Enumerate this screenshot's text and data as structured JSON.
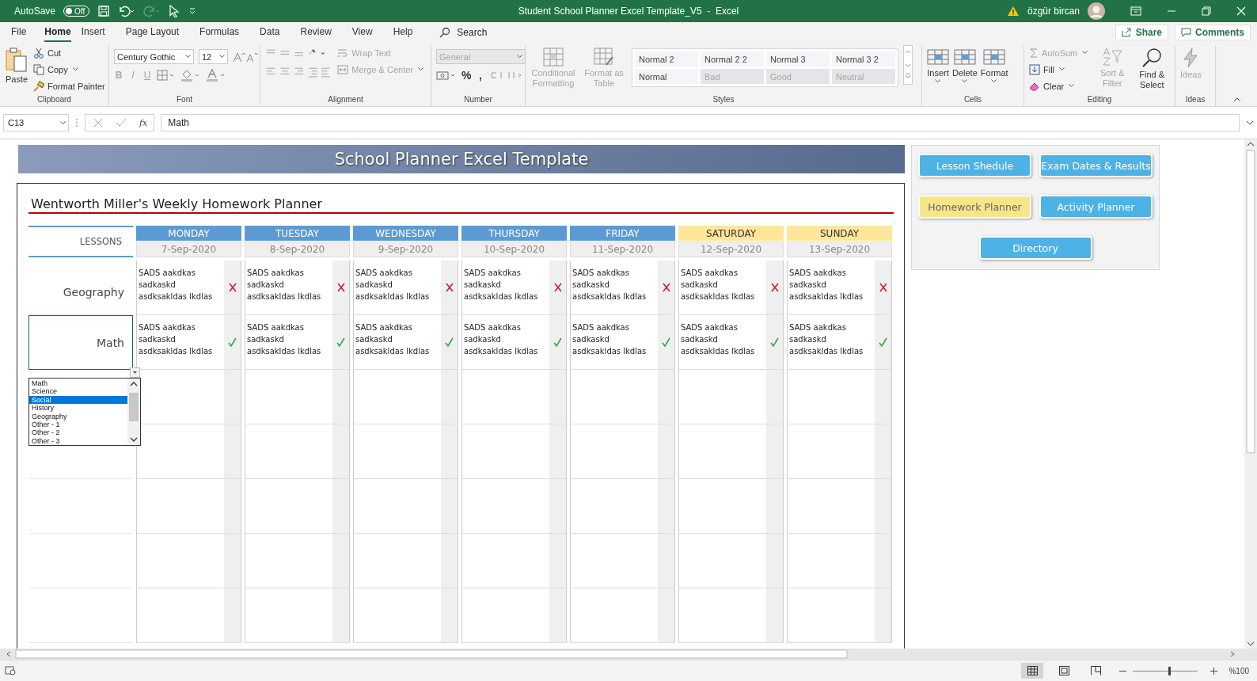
{
  "window": {
    "autosave": {
      "label": "AutoSave",
      "on": false,
      "state": "Off"
    },
    "title": "Student School Planner Excel Template_V5  -  Excel",
    "user": "özgür bircan"
  },
  "menu": {
    "tabs": [
      {
        "label": "File",
        "selected": false
      },
      {
        "label": "Home",
        "selected": true
      },
      {
        "label": "Insert",
        "selected": false
      },
      {
        "label": "Page Layout",
        "selected": false
      },
      {
        "label": "Formulas",
        "selected": false
      },
      {
        "label": "Data",
        "selected": false
      },
      {
        "label": "Review",
        "selected": false
      },
      {
        "label": "View",
        "selected": false
      },
      {
        "label": "Help",
        "selected": false
      }
    ],
    "search": "Search",
    "share": "Share",
    "comments": "Comments"
  },
  "ribbon": {
    "clipboard": {
      "label": "Clipboard",
      "paste": {
        "label": "Paste",
        "disabled": false
      },
      "cut": {
        "label": "Cut",
        "disabled": false
      },
      "copy": {
        "label": "Copy",
        "disabled": false
      },
      "format_painter": {
        "label": "Format Painter",
        "disabled": false
      }
    },
    "font": {
      "label": "Font",
      "name": "Century Gothic",
      "size": "12",
      "styles": [
        {
          "label": "B",
          "disabled": true
        },
        {
          "label": "I",
          "disabled": true
        },
        {
          "label": "U",
          "disabled": true
        }
      ]
    },
    "alignment": {
      "label": "Alignment",
      "wrap_text": {
        "label": "Wrap Text",
        "disabled": true
      },
      "merge": {
        "label": "Merge & Center",
        "disabled": true
      }
    },
    "number": {
      "label": "Number",
      "format": {
        "value": "General",
        "disabled": true
      },
      "symbols": [
        {
          "label": "%",
          "disabled": false
        },
        {
          "label": ",",
          "disabled": false
        }
      ]
    },
    "styles": {
      "label": "Styles",
      "conditional": {
        "label": "Conditional Formatting",
        "disabled": true
      },
      "format_table": {
        "label": "Format as Table",
        "disabled": true
      },
      "gallery": [
        {
          "label": "Normal 2",
          "disabled": false
        },
        {
          "label": "Normal 2 2",
          "disabled": false
        },
        {
          "label": "Normal 3",
          "disabled": false
        },
        {
          "label": "Normal 3 2",
          "disabled": false
        },
        {
          "label": "Normal",
          "disabled": false
        },
        {
          "label": "Bad",
          "disabled": true
        },
        {
          "label": "Good",
          "disabled": true
        },
        {
          "label": "Neutral",
          "disabled": true
        }
      ]
    },
    "cells": {
      "label": "Cells",
      "items": [
        {
          "label": "Insert",
          "disabled": false
        },
        {
          "label": "Delete",
          "disabled": false
        },
        {
          "label": "Format",
          "disabled": false
        }
      ]
    },
    "editing": {
      "label": "Editing",
      "autosum": {
        "label": "AutoSum",
        "disabled": true
      },
      "fill": {
        "label": "Fill",
        "disabled": false
      },
      "clear": {
        "label": "Clear",
        "disabled": false
      },
      "sort": {
        "label": "Sort & Filter",
        "disabled": true
      },
      "find": {
        "label": "Find & Select",
        "disabled": false
      }
    },
    "ideas": {
      "label": "Ideas",
      "button": {
        "label": "Ideas",
        "disabled": true
      }
    }
  },
  "formula_bar": {
    "name_box": "C13",
    "function_label": "fx",
    "value": "Math"
  },
  "sheet": {
    "banner": "School Planner Excel Template",
    "planner_title": "Wentworth Miller's Weekly Homework Planner",
    "lessons_label": "LESSONS",
    "days": [
      {
        "name": "MONDAY",
        "date": "7-Sep-2020",
        "color": "#5b9bd5"
      },
      {
        "name": "TUESDAY",
        "date": "8-Sep-2020",
        "color": "#5b9bd5"
      },
      {
        "name": "WEDNESDAY",
        "date": "9-Sep-2020",
        "color": "#5b9bd5"
      },
      {
        "name": "THURSDAY",
        "date": "10-Sep-2020",
        "color": "#5b9bd5"
      },
      {
        "name": "FRIDAY",
        "date": "11-Sep-2020",
        "color": "#5b9bd5"
      },
      {
        "name": "SATURDAY",
        "date": "12-Sep-2020",
        "color": "#ffe699"
      },
      {
        "name": "SUNDAY",
        "date": "13-Sep-2020",
        "color": "#ffe699"
      }
    ],
    "lessons": [
      {
        "subject": "Geography",
        "selected": false,
        "cells": [
          {
            "text": "SADS aakdkas sadkaskd asdksakldas lkdlas",
            "done": false
          },
          {
            "text": "SADS aakdkas sadkaskd asdksakldas lkdlas",
            "done": false
          },
          {
            "text": "SADS aakdkas sadkaskd asdksakldas lkdlas",
            "done": false
          },
          {
            "text": "SADS aakdkas sadkaskd asdksakldas lkdlas",
            "done": false
          },
          {
            "text": "SADS aakdkas sadkaskd asdksakldas lkdlas",
            "done": false
          },
          {
            "text": "SADS aakdkas sadkaskd asdksakldas lkdlas",
            "done": false
          },
          {
            "text": "SADS aakdkas sadkaskd asdksakldas lkdlas",
            "done": false
          }
        ]
      },
      {
        "subject": "Math",
        "selected": true,
        "cells": [
          {
            "text": "SADS aakdkas sadkaskd asdksakldas lkdlas",
            "done": true
          },
          {
            "text": "SADS aakdkas sadkaskd asdksakldas lkdlas",
            "done": true
          },
          {
            "text": "SADS aakdkas sadkaskd asdksakldas lkdlas",
            "done": true
          },
          {
            "text": "SADS aakdkas sadkaskd asdksakldas lkdlas",
            "done": true
          },
          {
            "text": "SADS aakdkas sadkaskd asdksakldas lkdlas",
            "done": true
          },
          {
            "text": "SADS aakdkas sadkaskd asdksakldas lkdlas",
            "done": true
          },
          {
            "text": "SADS aakdkas sadkaskd asdksakldas lkdlas",
            "done": true
          }
        ]
      }
    ],
    "dropdown": [
      {
        "label": "Math",
        "selected": false
      },
      {
        "label": "Science",
        "selected": false
      },
      {
        "label": "Social",
        "selected": true
      },
      {
        "label": "History",
        "selected": false
      },
      {
        "label": "Geography",
        "selected": false
      },
      {
        "label": "Other - 1",
        "selected": false
      },
      {
        "label": "Other - 2",
        "selected": false
      },
      {
        "label": "Other - 3",
        "selected": false
      }
    ],
    "nav_buttons": [
      {
        "label": "Lesson Shedule",
        "color": "#4db3e6"
      },
      {
        "label": "Exam Dates & Results",
        "color": "#4db3e6"
      },
      {
        "label": "Homework Planner",
        "color": "#f7e58a"
      },
      {
        "label": "Activity Planner",
        "color": "#4db3e6"
      },
      {
        "label": "Directory",
        "color": "#4db3e6"
      }
    ]
  },
  "status_bar": {
    "views": [
      {
        "kind": "normal",
        "selected": true
      },
      {
        "kind": "page_layout",
        "selected": false
      },
      {
        "kind": "page_break",
        "selected": false
      }
    ],
    "zoom": {
      "level": 0.55,
      "label": "%100"
    }
  }
}
